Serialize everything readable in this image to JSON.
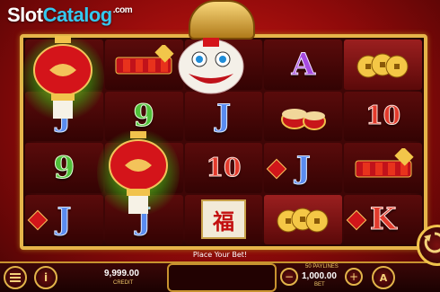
{
  "watermark": {
    "part1": "Slot",
    "part2": "Catalog",
    "part3": ".com"
  },
  "reels": [
    [
      "lantern",
      "firecrackers",
      "lion",
      "A",
      "coins"
    ],
    [
      "J",
      "9",
      "J",
      "drums",
      "10"
    ],
    [
      "9",
      "lantern",
      "10",
      "J",
      "firecrackers"
    ],
    [
      "J",
      "J",
      "fu",
      "coins",
      "K"
    ]
  ],
  "message": "Place Your Bet!",
  "credit": {
    "value": "9,999.00",
    "label": "CREDIT"
  },
  "bet": {
    "value": "1,000.00",
    "label": "BET",
    "paylines": "50 PAYLINES"
  },
  "controls": {
    "info_glyph": "i",
    "minus_glyph": "−",
    "plus_glyph": "+",
    "auto_glyph": "A"
  },
  "colors": {
    "gold": "#e6b54a",
    "red_bg": "#d21a14",
    "win_glow": "#82ff28"
  }
}
